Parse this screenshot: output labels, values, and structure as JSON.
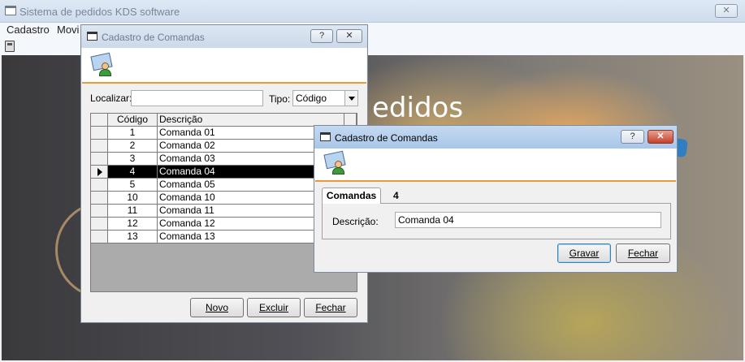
{
  "app": {
    "title": "Sistema de pedidos KDS software",
    "close_label": "✕",
    "menu": [
      {
        "label": "Cadastro"
      },
      {
        "label": "Movi"
      }
    ],
    "background_text": "edidos"
  },
  "list_dialog": {
    "title": "Cadastro de Comandas",
    "help_label": "?",
    "close_label": "✕",
    "search_label": "Localizar:",
    "search_value": "",
    "type_label": "Tipo:",
    "type_value": "Código",
    "columns": {
      "code": "Código",
      "description": "Descrição"
    },
    "rows": [
      {
        "code": "1",
        "description": "Comanda 01"
      },
      {
        "code": "2",
        "description": "Comanda 02"
      },
      {
        "code": "3",
        "description": "Comanda 03"
      },
      {
        "code": "4",
        "description": "Comanda 04"
      },
      {
        "code": "5",
        "description": "Comanda 05"
      },
      {
        "code": "10",
        "description": "Comanda 10"
      },
      {
        "code": "11",
        "description": "Comanda 11"
      },
      {
        "code": "12",
        "description": "Comanda 12"
      },
      {
        "code": "13",
        "description": "Comanda 13"
      }
    ],
    "selected_row_index": 3,
    "buttons": {
      "new": "Novo",
      "delete": "Excluir",
      "close": "Fechar"
    }
  },
  "edit_dialog": {
    "title": "Cadastro de Comandas",
    "help_label": "?",
    "close_label": "✕",
    "tab_label": "Comandas",
    "record_number": "4",
    "description_label": "Descrição:",
    "description_value": "Comanda 04",
    "buttons": {
      "save": "Gravar",
      "close": "Fechar"
    }
  }
}
